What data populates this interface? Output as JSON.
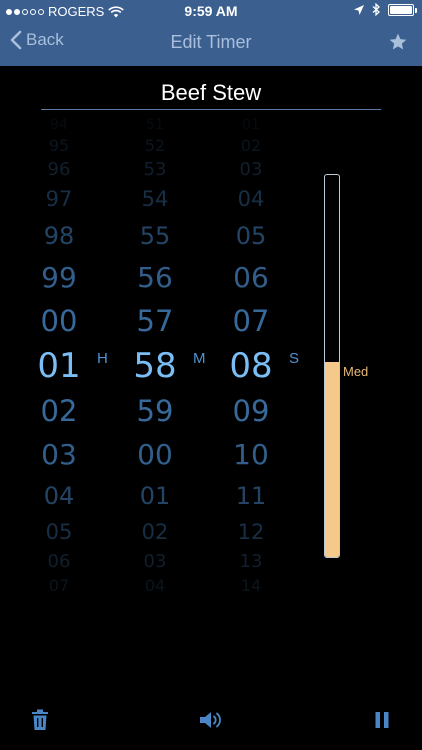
{
  "status_bar": {
    "carrier": "ROGERS",
    "time": "9:59 AM",
    "signal_bars_filled": 2,
    "signal_bars_total": 5,
    "battery_level": 1.0
  },
  "nav": {
    "back_label": "Back",
    "title": "Edit Timer",
    "favorite_icon": "star-icon"
  },
  "timer": {
    "name": "Beef Stew"
  },
  "picker": {
    "hours": {
      "values": [
        "94",
        "95",
        "96",
        "97",
        "98",
        "99",
        "00",
        "01",
        "02",
        "03",
        "04",
        "05",
        "06",
        "07"
      ],
      "selected": "01",
      "unit": "H"
    },
    "minutes": {
      "values": [
        "51",
        "52",
        "53",
        "54",
        "55",
        "56",
        "57",
        "58",
        "59",
        "00",
        "01",
        "02",
        "03",
        "04"
      ],
      "selected": "58",
      "unit": "M"
    },
    "seconds": {
      "values": [
        "01",
        "02",
        "03",
        "04",
        "05",
        "06",
        "07",
        "08",
        "09",
        "10",
        "11",
        "12",
        "13",
        "14"
      ],
      "selected": "08",
      "unit": "S"
    }
  },
  "heat": {
    "label": "Med",
    "level": 0.51
  },
  "toolbar": {
    "delete_icon": "trash-icon",
    "sound_icon": "speaker-icon",
    "pause_icon": "pause-icon"
  },
  "colors": {
    "nav_background": "#3b5f8f",
    "picker_text": "#3a6fa3",
    "picker_selected": "#7bbdf5",
    "heat_fill": "#f4c98a"
  }
}
